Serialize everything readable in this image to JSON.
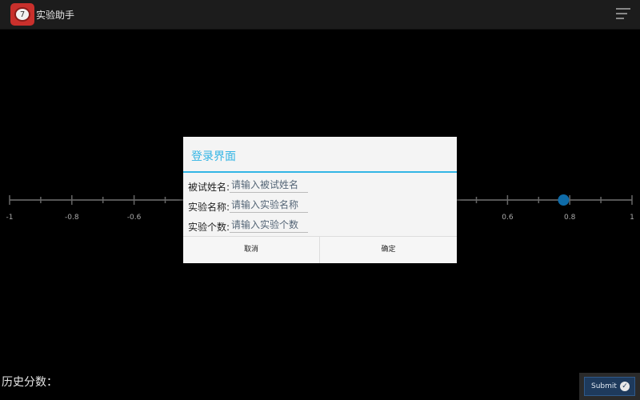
{
  "app": {
    "title": "实验助手",
    "icon_badge": "7"
  },
  "slider": {
    "min": -1,
    "max": 1,
    "value": 0.78,
    "tick_labels": [
      "-1",
      "-0.8",
      "-0.6",
      "0.6",
      "0.8",
      "1"
    ],
    "thumb_color": "#0e6ba8"
  },
  "dialog": {
    "title": "登录界面",
    "accent_color": "#33b5e5",
    "fields": [
      {
        "label": "被试姓名:",
        "placeholder": "请输入被试姓名",
        "value": ""
      },
      {
        "label": "实验名称:",
        "placeholder": "请输入实验名称",
        "value": ""
      },
      {
        "label": "实验个数:",
        "placeholder": "请输入实验个数",
        "value": ""
      }
    ],
    "cancel_label": "取消",
    "ok_label": "确定"
  },
  "footer": {
    "history_label": "历史分数：",
    "submit_label": "Submit"
  }
}
